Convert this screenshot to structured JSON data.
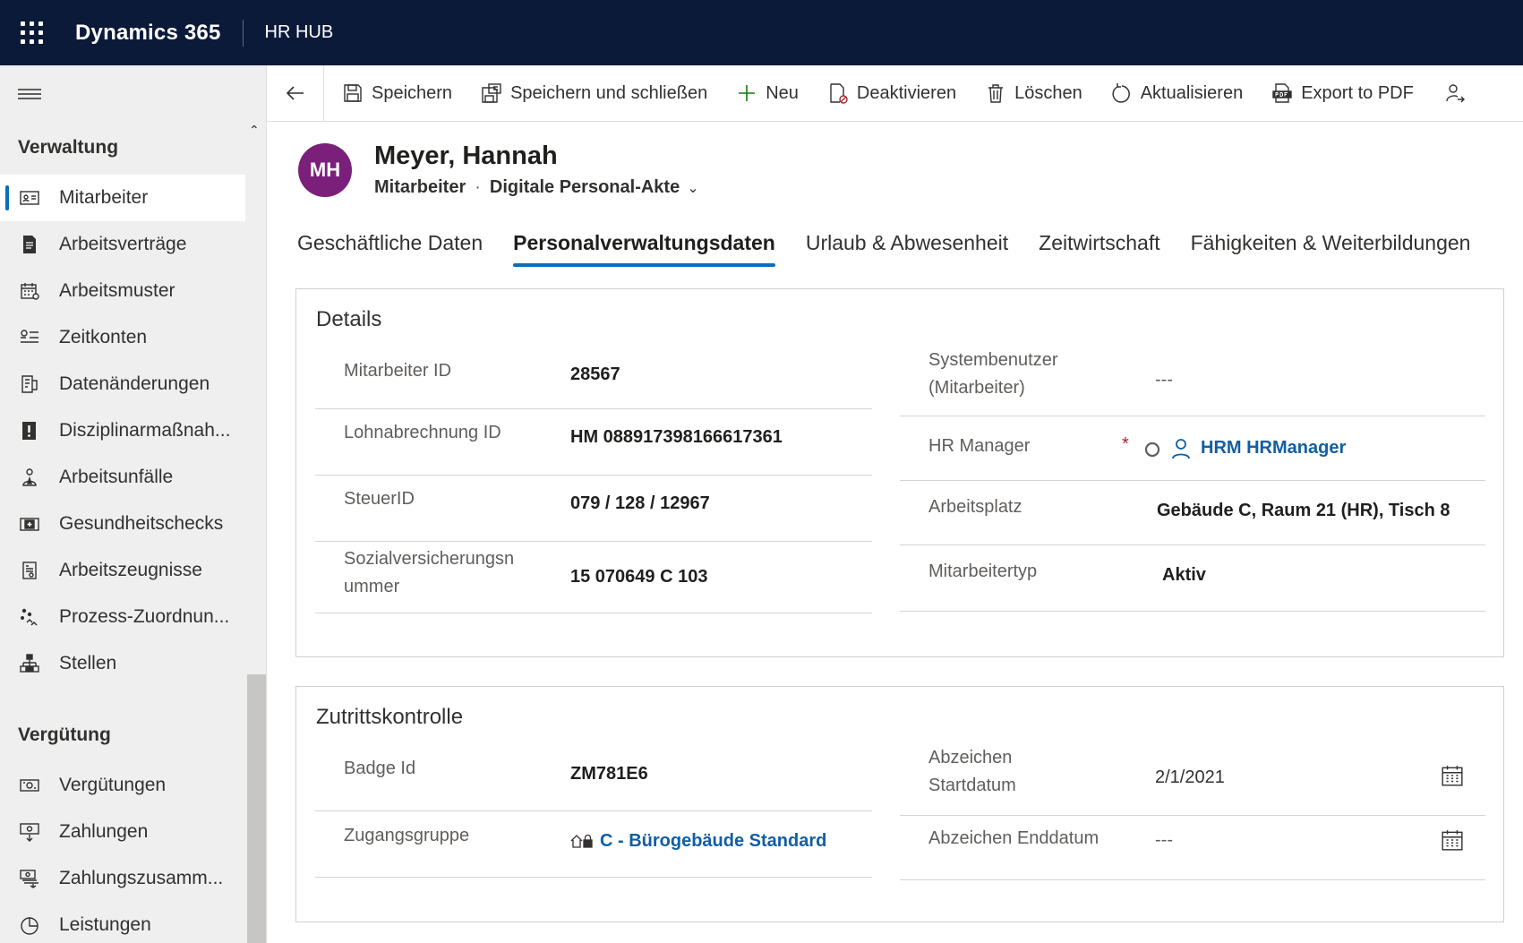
{
  "topbar": {
    "brand": "Dynamics 365",
    "app": "HR HUB"
  },
  "sidebar": {
    "groups": [
      {
        "title": "Verwaltung",
        "items": [
          {
            "label": "Mitarbeiter",
            "icon": "contact-card-icon",
            "active": true
          },
          {
            "label": "Arbeitsverträge",
            "icon": "document-icon"
          },
          {
            "label": "Arbeitsmuster",
            "icon": "calendar-grid-icon"
          },
          {
            "label": "Zeitkonten",
            "icon": "timer-list-icon"
          },
          {
            "label": "Datenänderungen",
            "icon": "document-edit-icon"
          },
          {
            "label": "Disziplinarmaßnah...",
            "icon": "warning-document-icon"
          },
          {
            "label": "Arbeitsunfälle",
            "icon": "person-warning-icon"
          },
          {
            "label": "Gesundheitschecks",
            "icon": "medical-icon"
          },
          {
            "label": "Arbeitszeugnisse",
            "icon": "certificate-icon"
          },
          {
            "label": "Prozess-Zuordnun...",
            "icon": "people-flow-icon"
          },
          {
            "label": "Stellen",
            "icon": "org-chart-icon"
          }
        ]
      },
      {
        "title": "Vergütung",
        "items": [
          {
            "label": "Vergütungen",
            "icon": "money-icon"
          },
          {
            "label": "Zahlungen",
            "icon": "money-down-icon"
          },
          {
            "label": "Zahlungszusamm...",
            "icon": "money-stack-icon"
          },
          {
            "label": "Leistungen",
            "icon": "pie-icon"
          }
        ]
      }
    ]
  },
  "commandbar": {
    "back": "back-arrow-icon",
    "items": [
      {
        "label": "Speichern",
        "icon": "save-icon"
      },
      {
        "label": "Speichern und schließen",
        "icon": "save-close-icon"
      },
      {
        "label": "Neu",
        "icon": "plus-icon"
      },
      {
        "label": "Deaktivieren",
        "icon": "deactivate-icon"
      },
      {
        "label": "Löschen",
        "icon": "delete-icon"
      },
      {
        "label": "Aktualisieren",
        "icon": "refresh-icon"
      },
      {
        "label": "Export to PDF",
        "icon": "pdf-icon"
      }
    ],
    "overflow": "assign-person-icon"
  },
  "record": {
    "initials": "MH",
    "avatar_color": "#7a1f7a",
    "name": "Meyer, Hannah",
    "entity": "Mitarbeiter",
    "form": "Digitale Personal-Akte"
  },
  "tabs": [
    {
      "label": "Geschäftliche Daten"
    },
    {
      "label": "Personalverwaltungsdaten",
      "active": true
    },
    {
      "label": "Urlaub & Abwesenheit"
    },
    {
      "label": "Zeitwirtschaft"
    },
    {
      "label": "Fähigkeiten & Weiterbildungen"
    }
  ],
  "details": {
    "title": "Details",
    "left": [
      {
        "label": "Mitarbeiter ID",
        "value": "28567"
      },
      {
        "label": "Lohnabrechnung ID",
        "value": "HM 088917398166617361"
      },
      {
        "label": "SteuerID",
        "value": "079 / 128 / 12967"
      },
      {
        "label_line1": "Sozialversicherungsn",
        "label_line2": "ummer",
        "value": "15 070649 C 103"
      }
    ],
    "right": [
      {
        "label_line1": "Systembenutzer",
        "label_line2": "(Mitarbeiter)",
        "value": "---"
      },
      {
        "label": "HR Manager",
        "required": "*",
        "value": "HRM HRManager"
      },
      {
        "label": "Arbeitsplatz",
        "value": "Gebäude C, Raum 21 (HR), Tisch 8"
      },
      {
        "label": "Mitarbeitertyp",
        "value": "Aktiv"
      }
    ]
  },
  "zutritt": {
    "title": "Zutrittskontrolle",
    "left": [
      {
        "label": "Badge Id",
        "value": "ZM781E6"
      },
      {
        "label": "Zugangsgruppe",
        "value": "C - Bürogebäude Standard"
      }
    ],
    "right": [
      {
        "label_line1": "Abzeichen",
        "label_line2": "Startdatum",
        "value": "2/1/2021"
      },
      {
        "label": "Abzeichen Enddatum",
        "value": "---"
      }
    ]
  },
  "colors": {
    "topbar": "#0c1a3a",
    "accent": "#0f6cbd",
    "link": "#115ea3"
  }
}
